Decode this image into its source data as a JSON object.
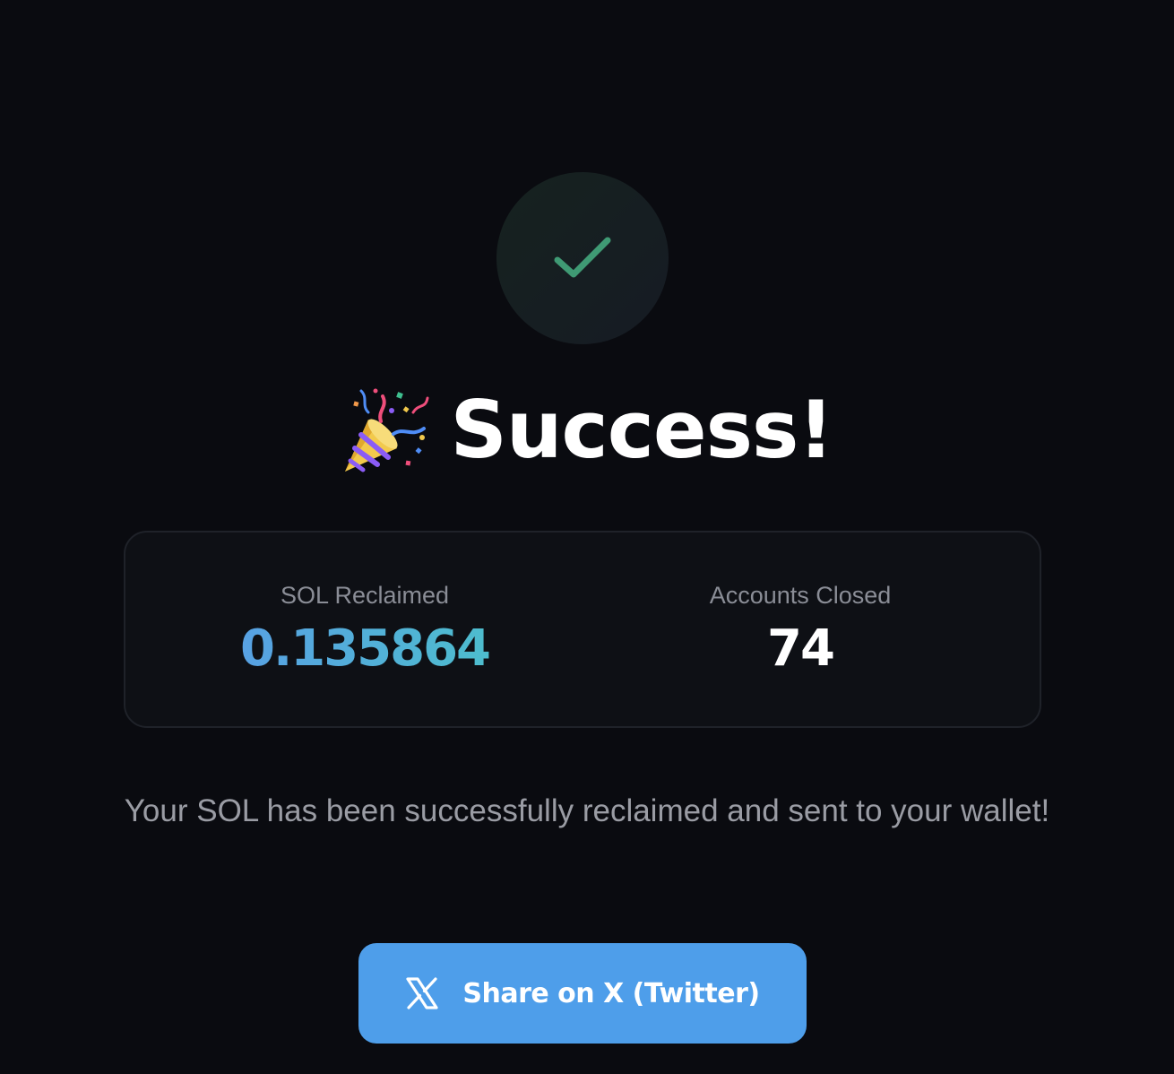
{
  "success_icon": {
    "name": "checkmark-icon",
    "color": "#3f9a74"
  },
  "heading": {
    "emoji_icon": "party-popper-icon",
    "title": "Success!"
  },
  "stats": {
    "sol_reclaimed": {
      "label": "SOL Reclaimed",
      "value": "0.135864"
    },
    "accounts_closed": {
      "label": "Accounts Closed",
      "value": "74"
    }
  },
  "message": "Your SOL has been successfully reclaimed and sent to your wallet!",
  "share_button": {
    "icon": "x-logo-icon",
    "label": "Share on X (Twitter)",
    "color": "#4e9eea"
  },
  "colors": {
    "background": "#0a0b10",
    "sol_gradient_start": "#5a9be8",
    "sol_gradient_end": "#4bc3c9"
  }
}
